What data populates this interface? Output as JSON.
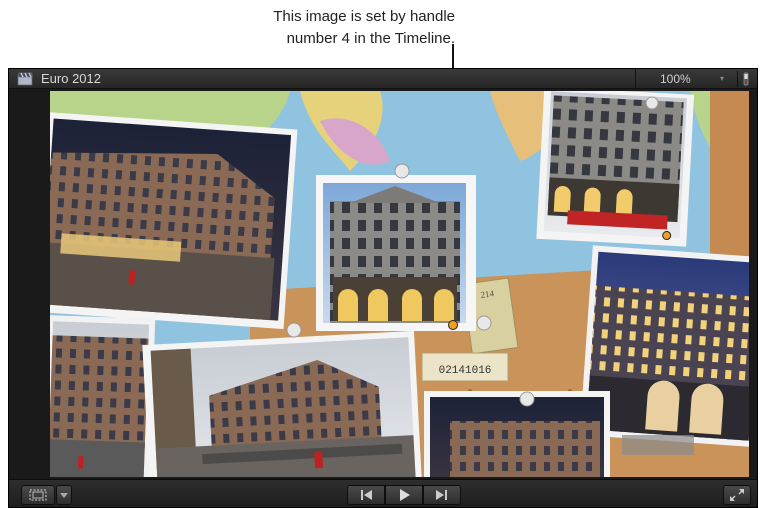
{
  "callout": {
    "line1": "This image is set by handle",
    "line2": "number 4 in the Timeline."
  },
  "viewer": {
    "project_title": "Euro 2012",
    "zoom_value": "100%",
    "zoom_caret": "▾"
  },
  "controls": {
    "view_options_caret": "▾"
  },
  "overlay": {
    "stamp_number": "02141016",
    "ticket_number": "214"
  },
  "colors": {
    "map_ocean": "#8fc3e0",
    "map_land_green": "#b8d48a",
    "map_land_yellow": "#e6d27a",
    "cork": "#c9935a",
    "handle_orange": "#f0a020",
    "viewer_bg": "#1a1a1a"
  },
  "icons": [
    "clapboard-icon",
    "switch-icon",
    "view-options-icon",
    "previous-icon",
    "play-icon",
    "next-icon",
    "fullscreen-icon"
  ]
}
